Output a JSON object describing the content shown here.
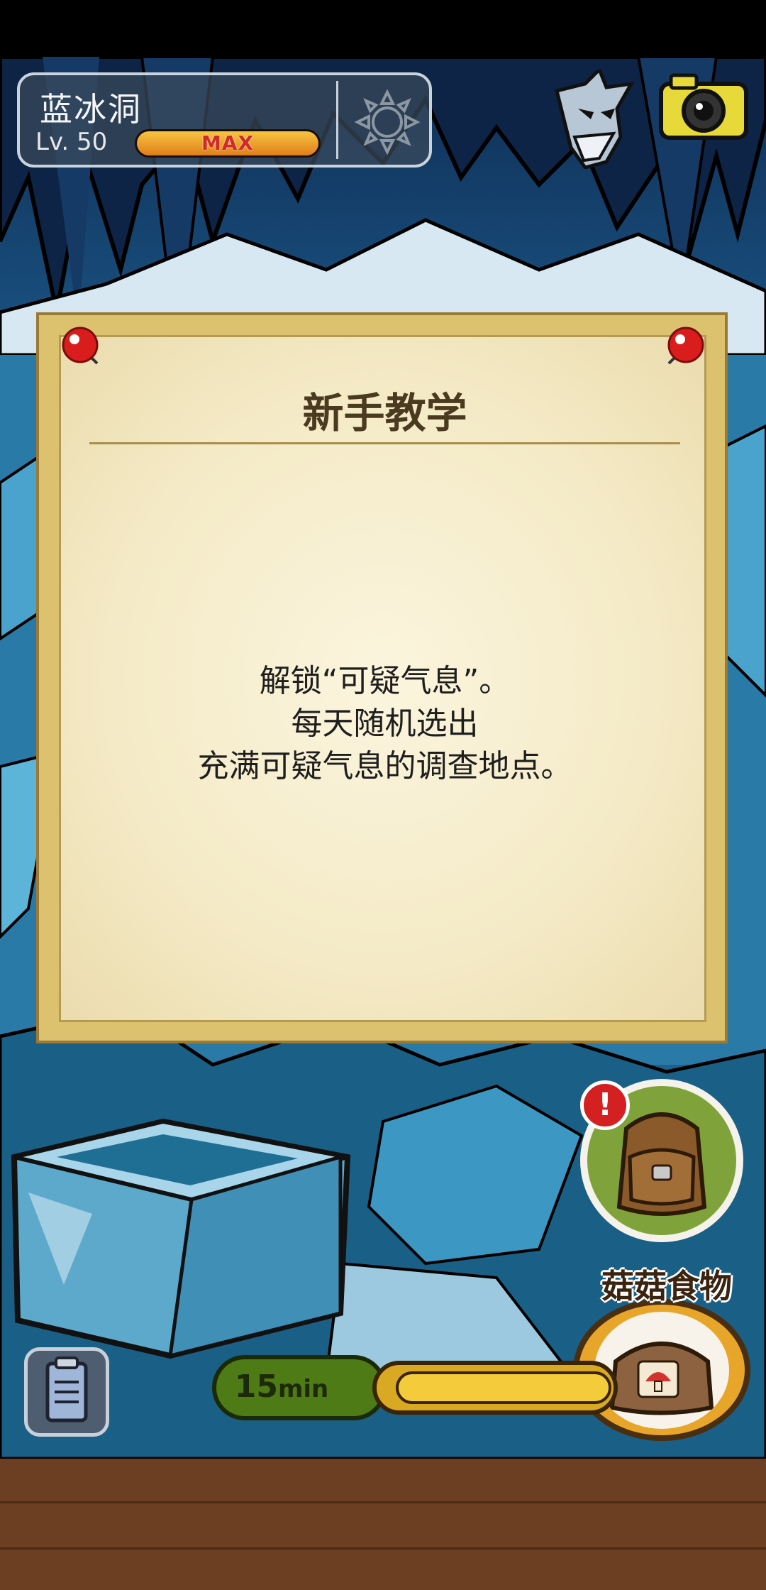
{
  "location": {
    "name": "蓝冰洞",
    "level_label": "Lv. 50",
    "level_max_text": "MAX",
    "level_progress": 1.0
  },
  "icons": {
    "weather": "sun-icon",
    "character": "character-portrait-icon",
    "camera": "camera-icon",
    "backpack": "backpack-icon",
    "alert": "alert-icon",
    "food": "mushroom-food-bag-icon",
    "clipboard": "clipboard-icon"
  },
  "notice": {
    "title": "新手教学",
    "line1": "解锁“可疑气息”。",
    "line2": "每天随机选出",
    "line3": "充满可疑气息的调查地点。"
  },
  "backpack": {
    "alert_symbol": "!"
  },
  "food": {
    "label": "菇菇食物"
  },
  "timer": {
    "value": "15",
    "unit": "min"
  },
  "colors": {
    "cave_blue": "#1d5a8a",
    "notice_frame": "#dcc16f",
    "notice_paper": "#f7efcf",
    "level_max_red": "#d12a2a",
    "floor_brown": "#6c3f22",
    "timer_green": "#5a8a1a",
    "timer_gold": "#d9a923"
  }
}
